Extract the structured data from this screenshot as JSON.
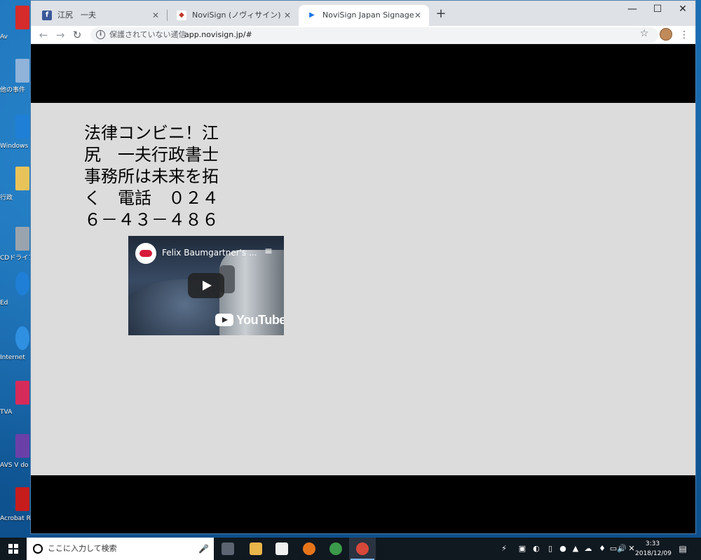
{
  "desktop": {
    "icons": [
      {
        "label": "Av",
        "color": "#d62b2b"
      },
      {
        "label": "他の事件",
        "color": "#8fb3d9"
      },
      {
        "label": "Windows システム",
        "color": "#1f7fd6"
      },
      {
        "label": "行政",
        "color": "#e8c35a"
      },
      {
        "label": "CDドライブ カ",
        "color": "#9aa4ae"
      },
      {
        "label": "Ed",
        "color": "#1f7fd6"
      },
      {
        "label": "Internet",
        "color": "#2f8fe0"
      },
      {
        "label": "TVA",
        "color": "#d62b5a"
      },
      {
        "label": "AVS V do",
        "color": "#6a3fa8"
      },
      {
        "label": "Acrobat R",
        "color": "#c71c1c"
      }
    ]
  },
  "browser": {
    "tabs": [
      {
        "title": "江尻　一夫",
        "favicon_color": "#3b5998",
        "favicon_glyph": "f"
      },
      {
        "title": "NoviSign (ノヴィサイン)",
        "favicon_color": "#c0392b",
        "favicon_glyph": "◆"
      },
      {
        "title": "NoviSign Japan Signage",
        "favicon_color": "#1a73e8",
        "favicon_glyph": "▶"
      }
    ],
    "new_tab_glyph": "+",
    "window_controls": {
      "minimize": "—",
      "maximize": "☐",
      "close": "✕"
    },
    "nav": {
      "back": "←",
      "forward": "→",
      "reload": "↻"
    },
    "address": {
      "security_label": "保護されていない通信",
      "url": "app.novisign.jp/#"
    },
    "bookmark_glyph": "☆",
    "menu_glyph": "⋮"
  },
  "signage": {
    "text": "法律コンビニ！江尻　一夫行政書士事務所は未来を拓く　電話　０２４６－４３－４８６",
    "video": {
      "title": "Felix Baumgartner's ...",
      "playlist_glyph": "≡",
      "brand": "YouTube"
    }
  },
  "taskbar": {
    "search_placeholder": "ここに入力して検索",
    "mic_glyph": "🎤",
    "apps": [
      {
        "name": "task-view",
        "color": "#5b6470"
      },
      {
        "name": "file-explorer",
        "color": "#e8b64a"
      },
      {
        "name": "store",
        "color": "#f0f0f0"
      },
      {
        "name": "firefox",
        "color": "#e8741a"
      },
      {
        "name": "chrome",
        "color": "#3a9a4a"
      },
      {
        "name": "chrome-active",
        "color": "#d6483a"
      }
    ],
    "tray": [
      "⚡",
      "▣",
      "◐",
      "▯",
      "●",
      "▲",
      "☁",
      "♦",
      "▭",
      "🔊",
      "✕"
    ],
    "clock_time": "3:33",
    "clock_date": "2018/12/09",
    "notification_glyph": "▤"
  }
}
